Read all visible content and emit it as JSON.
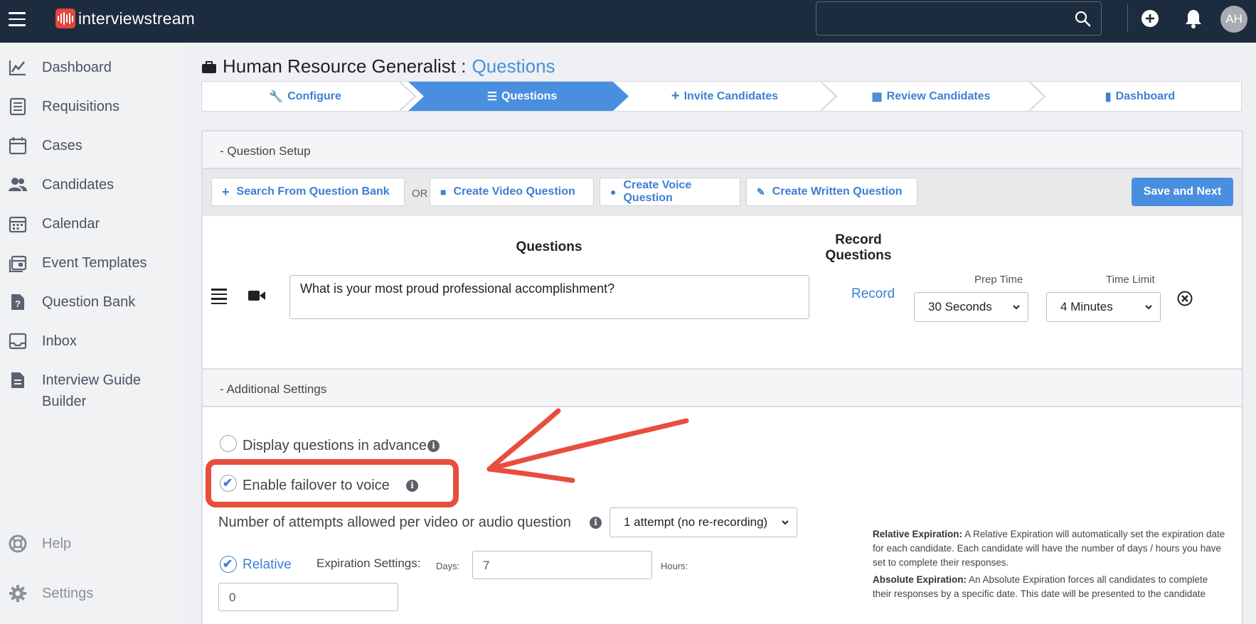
{
  "app": {
    "brand": "interviewstream",
    "user_initials": "AH"
  },
  "search": {
    "placeholder": ""
  },
  "sidebar": {
    "items": [
      {
        "label": "Dashboard",
        "icon": "chart-line-icon"
      },
      {
        "label": "Requisitions",
        "icon": "list-doc-icon"
      },
      {
        "label": "Cases",
        "icon": "calendar-icon"
      },
      {
        "label": "Candidates",
        "icon": "people-icon"
      },
      {
        "label": "Calendar",
        "icon": "calendar-grid-icon"
      },
      {
        "label": "Event Templates",
        "icon": "template-calendar-icon"
      },
      {
        "label": "Question Bank",
        "icon": "question-doc-icon"
      },
      {
        "label": "Inbox",
        "icon": "inbox-icon"
      },
      {
        "label": "Interview Guide Builder",
        "icon": "document-icon"
      }
    ],
    "help": "Help",
    "settings": "Settings"
  },
  "page": {
    "title": "Human Resource Generalist :",
    "section": "Questions"
  },
  "steps": [
    {
      "label": "Configure",
      "icon": "wrench-icon",
      "active": false
    },
    {
      "label": "Questions",
      "icon": "numbered-list-icon",
      "active": true
    },
    {
      "label": "Invite Candidates",
      "icon": "plus-icon",
      "active": false
    },
    {
      "label": "Review Candidates",
      "icon": "download-box-icon",
      "active": false
    },
    {
      "label": "Dashboard",
      "icon": "bar-chart-icon",
      "active": false
    }
  ],
  "question_setup": {
    "header": "- Question Setup",
    "search_bank": "Search From Question Bank",
    "or": "OR",
    "create_video": "Create Video Question",
    "create_voice": "Create Voice Question",
    "create_written": "Create Written Question",
    "save_next": "Save and Next",
    "col_questions": "Questions",
    "col_record_1": "Record",
    "col_record_2": "Questions",
    "prep_time_label": "Prep Time",
    "time_limit_label": "Time Limit",
    "question_text": "What is your most proud professional accomplishment?",
    "record_link": "Record",
    "prep_time_value": "30 Seconds",
    "time_limit_value": "4 Minutes"
  },
  "additional_settings": {
    "header": "- Additional Settings",
    "display_in_advance": "Display questions in advance",
    "display_in_advance_checked": false,
    "failover_voice": "Enable failover to voice",
    "failover_voice_checked": true,
    "attempts_label": "Number of attempts allowed per video or audio question",
    "attempts_value": "1 attempt (no re-recording)",
    "relative_label": "Relative",
    "relative_checked": true,
    "expiration_label": "Expiration Settings:",
    "days_label": "Days:",
    "days_value": "7",
    "hours_label": "Hours:",
    "hours_value": "0",
    "relative_help_title": "Relative Expiration:",
    "relative_help_body": "A Relative Expiration will automatically set the expiration date for each candidate. Each candidate will have the number of days / hours you have set to complete their responses.",
    "absolute_help_title": "Absolute Expiration:",
    "absolute_help_body": "An Absolute Expiration forces all candidates to complete their responses by a specific date. This date will be presented to the candidate during the"
  },
  "annotation": {
    "color": "#e84d3e"
  },
  "colors": {
    "accent": "#4a8fdf",
    "topbar": "#1c2b3e"
  }
}
